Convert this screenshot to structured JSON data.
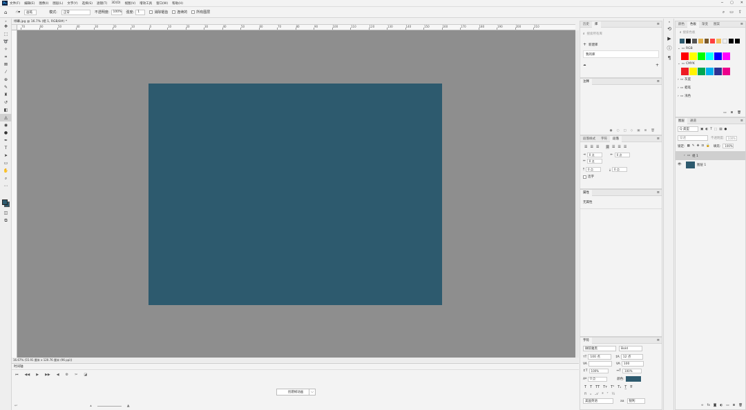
{
  "menu": {
    "logo": "Ps",
    "items": [
      "文件(F)",
      "编辑(E)",
      "图像(I)",
      "图层(L)",
      "文字(Y)",
      "选择(S)",
      "滤镜(T)",
      "3D(D)",
      "视图(V)",
      "增效工具",
      "窗口(W)",
      "帮助(H)"
    ],
    "window_controls": [
      "─",
      "▢",
      "✕"
    ]
  },
  "options": {
    "brush_label": "画笔",
    "mode_label": "模式:",
    "mode_value": "正常",
    "opacity_label": "不透明度:",
    "opacity_value": "100%",
    "strength_label": "强度:",
    "strength_value": "1",
    "check1": "消除锯齿",
    "check2": "连续的",
    "check3": "所有图层"
  },
  "document": {
    "tab_title": "绿幕.jpg @ 16.7% (组 1, RGB/8#) *",
    "ruler_h_labels": [
      "70",
      "60",
      "50",
      "40",
      "30",
      "20",
      "10",
      "0",
      "10",
      "20",
      "30",
      "40",
      "50",
      "60",
      "70",
      "80",
      "90",
      "100",
      "110",
      "120",
      "130",
      "140",
      "150",
      "160",
      "170",
      "180",
      "190",
      "200",
      "210"
    ],
    "status_text": "16.67%   (55.91 厘米 x 120.76 厘米 (96 ppi))",
    "artboard_color": "#2d5a6e",
    "canvas_bg": "#8e8e8e"
  },
  "timeline": {
    "title": "时间轴",
    "create_button": "创建帧动画",
    "dropdown_arrow": "⌵"
  },
  "history_panel": {
    "tabs": [
      "历史",
      "库"
    ],
    "search_placeholder": "搜索所有库",
    "create_label": "新建库",
    "my_library": "我的库"
  },
  "comments_panel": {
    "tabs": [
      "注释"
    ]
  },
  "paragraph_panel": {
    "tabs": [
      "段落样式",
      "字符",
      "段落"
    ],
    "fields": [
      "0 点",
      "0 点",
      "0 点",
      "0 点",
      "0 点"
    ],
    "hyphenate": "连字"
  },
  "properties_panel": {
    "tabs": [
      "属性"
    ],
    "empty_text": "无属性"
  },
  "character_panel": {
    "tabs": [
      "字符"
    ],
    "font_family": "微软雅黑",
    "font_style": "Bold",
    "size": "100 点",
    "leading": "12 点",
    "tracking_label": "VA",
    "tracking_value": "100",
    "vscale": "100%",
    "hscale": "100%",
    "baseline": "0 点",
    "color_label": "颜色:",
    "color_value": "#2d5a6e",
    "language": "美国英语",
    "aa": "锐利"
  },
  "swatches_panel": {
    "tabs": [
      "颜色",
      "色板",
      "渐变",
      "图案"
    ],
    "search_placeholder": "搜索色板",
    "recent": [
      "#2d5a6e",
      "#000000",
      "#555555",
      "#e3b04b",
      "#7a5a2b",
      "#ff4040",
      "#f0c060",
      "#f0f0f0",
      "#000000",
      "#000000"
    ],
    "groups": [
      {
        "name": "RGB",
        "colors": [
          "#ff0000",
          "#ffff00",
          "#00ff00",
          "#00ffff",
          "#0000ff",
          "#ff00ff"
        ]
      },
      {
        "name": "CMYK",
        "colors": [
          "#ed1c24",
          "#fff200",
          "#00a651",
          "#00aeef",
          "#2e3192",
          "#ec008c"
        ]
      },
      {
        "name": "灰度"
      },
      {
        "name": "蜡笔"
      },
      {
        "name": "浅色"
      }
    ]
  },
  "layers_panel": {
    "tabs": [
      "图层",
      "通道"
    ],
    "filter_label": "Q 类型",
    "blend_mode": "穿透",
    "opacity_label": "不透明度:",
    "opacity_value": "100%",
    "lock_label": "锁定:",
    "fill_label": "填充:",
    "fill_value": "100%",
    "layers": [
      {
        "name": "组 1",
        "type": "group"
      },
      {
        "name": "图层 1",
        "type": "layer",
        "thumb": "#2d5a6e"
      }
    ]
  }
}
